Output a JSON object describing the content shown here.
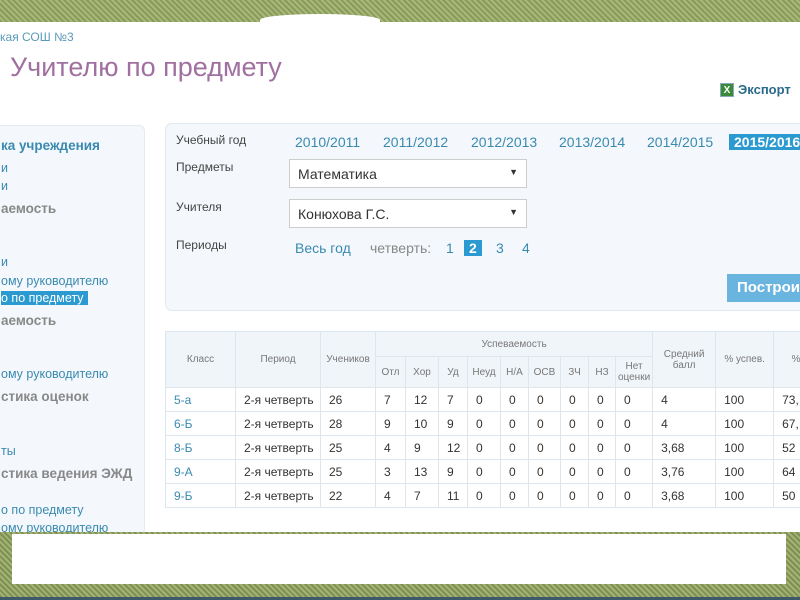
{
  "school": "кая СОШ №3",
  "title": "Учителю по предмету",
  "export_label": "Экспорт",
  "sidebar": {
    "items": [
      {
        "label": "ка учреждения",
        "style": "b blue"
      },
      {
        "label": "и",
        "style": ""
      },
      {
        "label": "и",
        "style": ""
      },
      {
        "label": "аемость",
        "style": "b"
      },
      {
        "label": "и",
        "style": ""
      },
      {
        "label": "ому руководителю",
        "style": ""
      },
      {
        "label": "о по предмету",
        "style": "sel"
      },
      {
        "label": "аемость",
        "style": "b"
      },
      {
        "label": "ому руководителю",
        "style": ""
      },
      {
        "label": "стика оценок",
        "style": "b"
      },
      {
        "label": "ты",
        "style": ""
      },
      {
        "label": "стика ведения ЭЖД",
        "style": "b"
      },
      {
        "label": "о по предмету",
        "style": ""
      },
      {
        "label": "ому руководителю",
        "style": ""
      }
    ]
  },
  "filters": {
    "year_label": "Учебный год",
    "years": [
      "2010/2011",
      "2011/2012",
      "2012/2013",
      "2013/2014",
      "2014/2015",
      "2015/2016"
    ],
    "selected_year": "2015/2016",
    "subject_label": "Предметы",
    "subject_value": "Математика",
    "teacher_label": "Учителя",
    "teacher_value": "Конюхова Г.С.",
    "periods_label": "Периоды",
    "whole_year": "Весь год",
    "quarter_label": "четверть:",
    "quarters": [
      "1",
      "2",
      "3",
      "4"
    ],
    "selected_quarter": "2",
    "build_label": "Построить"
  },
  "table": {
    "headers": {
      "class": "Класс",
      "period": "Период",
      "students": "Учеников",
      "progress": "Успеваемость",
      "avg": "Средний балл",
      "pct_success": "% успев.",
      "pct_quality": "% к"
    },
    "sub_headers": [
      "Отл",
      "Хор",
      "Уд",
      "Неуд",
      "Н/А",
      "ОСВ",
      "ЗЧ",
      "НЗ",
      "Нет оценки"
    ],
    "rows": [
      [
        "5-а",
        "2-я четверть",
        "26",
        "7",
        "12",
        "7",
        "0",
        "0",
        "0",
        "0",
        "0",
        "0",
        "4",
        "100",
        "73,"
      ],
      [
        "6-Б",
        "2-я четверть",
        "28",
        "9",
        "10",
        "9",
        "0",
        "0",
        "0",
        "0",
        "0",
        "0",
        "4",
        "100",
        "67,"
      ],
      [
        "8-Б",
        "2-я четверть",
        "25",
        "4",
        "9",
        "12",
        "0",
        "0",
        "0",
        "0",
        "0",
        "0",
        "3,68",
        "100",
        "52"
      ],
      [
        "9-А",
        "2-я четверть",
        "25",
        "3",
        "13",
        "9",
        "0",
        "0",
        "0",
        "0",
        "0",
        "0",
        "3,76",
        "100",
        "64"
      ],
      [
        "9-Б",
        "2-я четверть",
        "22",
        "4",
        "7",
        "11",
        "0",
        "0",
        "0",
        "0",
        "0",
        "0",
        "3,68",
        "100",
        "50"
      ]
    ]
  }
}
